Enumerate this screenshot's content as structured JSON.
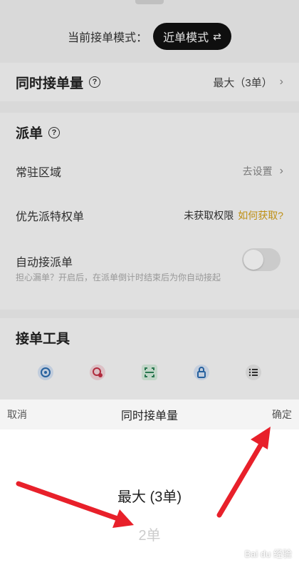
{
  "mode": {
    "label": "当前接单模式：",
    "value": "近单模式"
  },
  "quantity": {
    "title": "同时接单量",
    "value": "最大（3单）"
  },
  "dispatch": {
    "title": "派单",
    "area": {
      "label": "常驻区域",
      "action": "去设置"
    },
    "priority": {
      "label": "优先派特权单",
      "status": "未获取权限",
      "link": "如何获取?"
    },
    "auto": {
      "label": "自动接派单",
      "desc": "担心漏单？开启后，在派单倒计时结束后为你自动接起",
      "enabled": false
    }
  },
  "tools": {
    "title": "接单工具",
    "icons": [
      "target-icon",
      "location-icon",
      "scan-icon",
      "lock-icon",
      "list-icon"
    ]
  },
  "sheet": {
    "cancel": "取消",
    "title": "同时接单量",
    "confirm": "确定",
    "options": [
      "最大 (3单)",
      "2单"
    ],
    "selected": "最大 (3单)"
  },
  "watermark": "Bai du 经验",
  "colors": {
    "accent_gold": "#d4a017",
    "arrow_red": "#e8202a",
    "pill_bg": "#111111"
  }
}
